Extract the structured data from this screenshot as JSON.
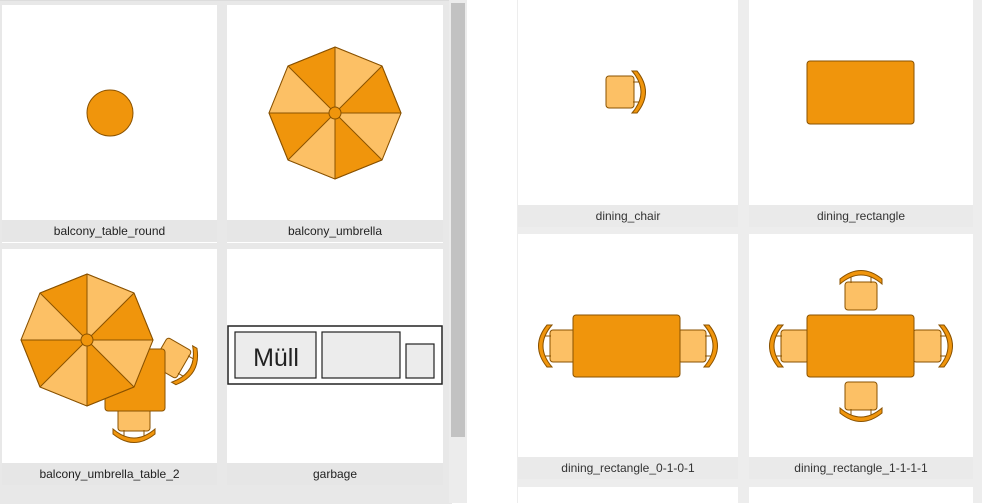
{
  "colors": {
    "orange": "#f0950c",
    "orange_light": "#fcc065",
    "stroke": "#8a5200",
    "card_bg": "#ffffff",
    "panel_bg": "#e8e8e8"
  },
  "left_panel": {
    "items": [
      {
        "label": "balcony_table_round",
        "icon": "round-table-icon"
      },
      {
        "label": "balcony_umbrella",
        "icon": "umbrella-icon"
      },
      {
        "label": "balcony_umbrella_table_2",
        "icon": "umbrella-table-icon"
      },
      {
        "label": "garbage",
        "icon": "garbage-icon",
        "text": "Müll"
      }
    ]
  },
  "right_panel": {
    "items": [
      {
        "label": "dining_chair",
        "icon": "chair-icon"
      },
      {
        "label": "dining_rectangle",
        "icon": "rectangle-table-icon"
      },
      {
        "label": "dining_rectangle_0-1-0-1",
        "icon": "table-two-chairs-icon"
      },
      {
        "label": "dining_rectangle_1-1-1-1",
        "icon": "table-four-chairs-icon"
      }
    ]
  }
}
